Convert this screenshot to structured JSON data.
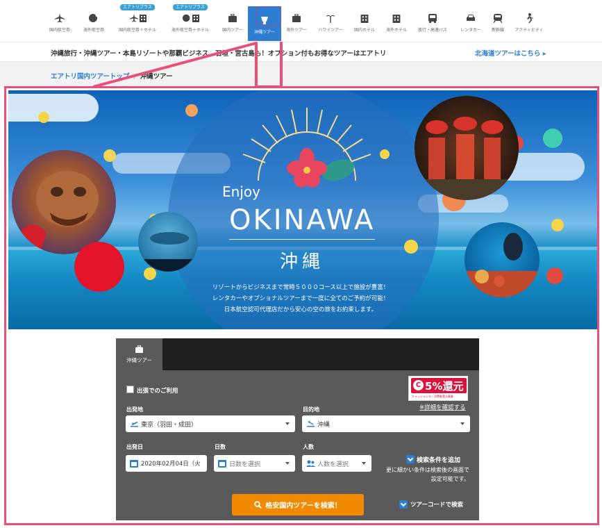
{
  "nav": {
    "items": [
      {
        "label": "国内航空券",
        "badge": "",
        "icon": "plane-icon"
      },
      {
        "label": "海外航空券",
        "badge": "",
        "icon": "globe-plane-icon"
      },
      {
        "label": "国内航空券＋ホテル",
        "badge": "エアトリプラス",
        "icon": "plane-hotel-icon"
      },
      {
        "label": "海外航空券＋ホテル",
        "badge": "エアトリプラス",
        "icon": "globe-hotel-icon"
      },
      {
        "label": "国内ツアー",
        "badge": "",
        "icon": "suitcase-icon"
      },
      {
        "label": "沖縄ツアー",
        "badge": "",
        "icon": "okinawa-icon"
      },
      {
        "label": "海外ツアー",
        "badge": "",
        "icon": "suitcase-icon"
      },
      {
        "label": "ハワイツアー",
        "badge": "",
        "icon": "palm-tree-icon"
      },
      {
        "label": "国内ホテル",
        "badge": "",
        "icon": "building-icon"
      },
      {
        "label": "海外ホテル",
        "badge": "",
        "icon": "building-icon"
      },
      {
        "label": "夜行・高速バス",
        "badge": "",
        "icon": "bus-icon"
      },
      {
        "label": "レンタカー",
        "badge": "",
        "icon": "car-icon"
      },
      {
        "label": "新幹線",
        "badge": "",
        "icon": "train-icon"
      },
      {
        "label": "アクティビティ",
        "badge": "",
        "icon": "activity-icon"
      }
    ],
    "active_index": 5
  },
  "infobar": {
    "message": "沖縄旅行・沖縄ツアー・本島リゾートや那覇ビジネス、石垣・宮古島も！オプション付もお得なツアーはエアトリ",
    "link": "北海道ツアーはこちら ▸"
  },
  "breadcrumb": {
    "home": "エアトリ国内ツアートップ",
    "separator": "/",
    "current": "沖縄ツアー"
  },
  "hero": {
    "enjoy": "Enjoy",
    "title": "OKINAWA",
    "kanji": "沖縄",
    "lines": [
      "リゾートからビジネスまで常時５０００コース以上で施設が豊富！",
      "レンタカーやオプショナルツアーまで一度に全てのご予約が可能！",
      "日本航空認可代理店だから安心の空の旅をお約束します。"
    ]
  },
  "search": {
    "tab_label": "沖縄ツアー",
    "business_trip_label": "出張でのご利用",
    "campaign": {
      "value": "5%還元",
      "sub": "キャッシュレス・消費者還元事業",
      "link": "※詳細を確認する"
    },
    "origin": {
      "label": "出発地",
      "value": "東京（羽田・成田）"
    },
    "destination": {
      "label": "目的地",
      "value": "沖縄"
    },
    "date": {
      "label": "出発日",
      "value": "2020年02月04日（火"
    },
    "nights": {
      "label": "日数",
      "placeholder": "日数を選択"
    },
    "people": {
      "label": "人数",
      "placeholder": "人数を選択"
    },
    "add_conditions": "検索条件を追加",
    "add_note_1": "更に細かい条件は検索後の画面で",
    "add_note_2": "設定可能です。",
    "search_button": "格安国内ツアーを検索！",
    "tour_code": "ツアーコードで検索"
  },
  "colors": {
    "accent": "#2d7ed1",
    "highlight": "#e94f79",
    "search_button": "#f08a00",
    "panel": "#5a5a5a",
    "campaign": "#d7143b"
  }
}
